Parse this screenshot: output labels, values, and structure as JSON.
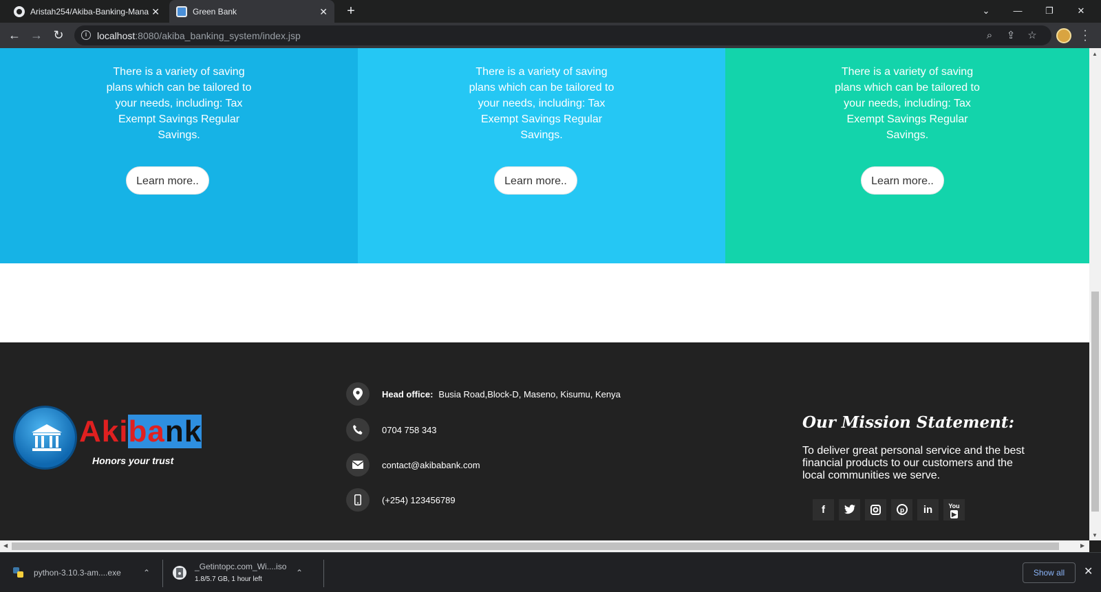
{
  "browser": {
    "tabs": [
      {
        "title": "Aristah254/Akiba-Banking-Mana",
        "icon": "github-icon"
      },
      {
        "title": "Green Bank",
        "icon": "bank-favicon-icon"
      }
    ],
    "url_host": "localhost",
    "url_rest": ":8080/akiba_banking_system/index.jsp"
  },
  "panels": [
    {
      "text": "There is a variety of saving plans which can be tailored to your needs, including: Tax Exempt Savings Regular Savings.",
      "button": "Learn more..",
      "color": "#16b3e6"
    },
    {
      "text": "There is a variety of saving plans which can be tailored to your needs, including: Tax Exempt Savings Regular Savings.",
      "button": "Learn more..",
      "color": "#25c7f4"
    },
    {
      "text": "There is a variety of saving plans which can be tailored to your needs, including: Tax Exempt Savings Regular Savings.",
      "button": "Learn more..",
      "color": "#13d4ab"
    }
  ],
  "footer": {
    "logo": {
      "part1": "Aki",
      "part2": "ba",
      "part3": "nk",
      "tagline": "Honors your trust"
    },
    "contacts": {
      "office_label": "Head office:",
      "office_value": "Busia Road,Block-D, Maseno, Kisumu, Kenya",
      "phone": "0704 758 343",
      "email": "contact@akibabank.com",
      "mobile": "(+254) 123456789"
    },
    "mission_title": "Our Mission Statement:",
    "mission_text": "To deliver great personal service and the best financial products to our customers and the local communities we serve.",
    "social": [
      "f",
      "t",
      "ig",
      "p",
      "in",
      "yt"
    ]
  },
  "downloads": [
    {
      "name": "python-3.10.3-am....exe"
    },
    {
      "name": "_Getintopc.com_Wi....iso",
      "status": "1.8/5.7 GB, 1 hour left"
    }
  ],
  "show_all": "Show all"
}
